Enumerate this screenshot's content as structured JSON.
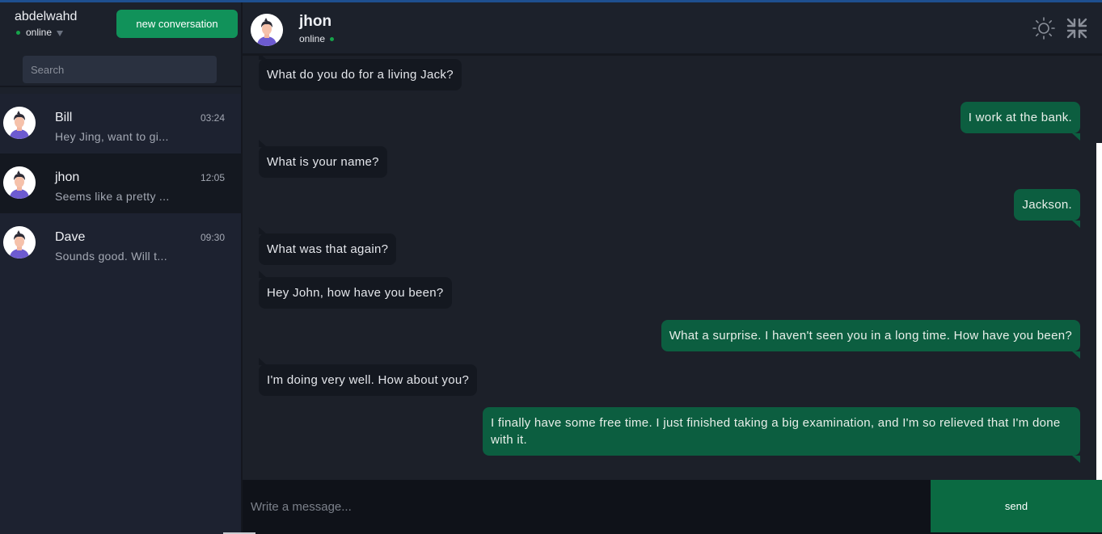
{
  "user": {
    "name": "abdelwahd",
    "status": "online",
    "new_conversation_label": "new conversation",
    "search_placeholder": "Search"
  },
  "conversations": [
    {
      "name": "Bill",
      "time": "03:24",
      "preview": "Hey Jing, want to gi..."
    },
    {
      "name": "jhon",
      "time": "12:05",
      "preview": "Seems like a pretty ..."
    },
    {
      "name": "Dave",
      "time": "09:30",
      "preview": "Sounds good. Will t..."
    }
  ],
  "chat": {
    "name": "jhon",
    "status": "online",
    "messages": [
      {
        "dir": "in",
        "text": "What do you do for a living Jack?"
      },
      {
        "dir": "out",
        "text": "I work at the bank."
      },
      {
        "dir": "in",
        "text": "What is your name?"
      },
      {
        "dir": "out",
        "text": "Jackson."
      },
      {
        "dir": "in",
        "text": "What was that again?"
      },
      {
        "dir": "in",
        "text": "Hey John, how have you been?"
      },
      {
        "dir": "out",
        "text": "What a surprise. I haven't seen you in a long time. How have you been?"
      },
      {
        "dir": "in",
        "text": "I'm doing very well. How about you?"
      },
      {
        "dir": "out",
        "text": "I finally have some free time. I just finished taking a big examination, and I'm so relieved that I'm done with it."
      }
    ]
  },
  "composer": {
    "placeholder": "Write a message...",
    "send_label": "send"
  },
  "icons": {
    "theme": "sun-icon",
    "collapse": "compress-icon"
  },
  "colors": {
    "accent": "#11925a",
    "outgoing": "#0c5e40",
    "online": "#16a34a"
  }
}
